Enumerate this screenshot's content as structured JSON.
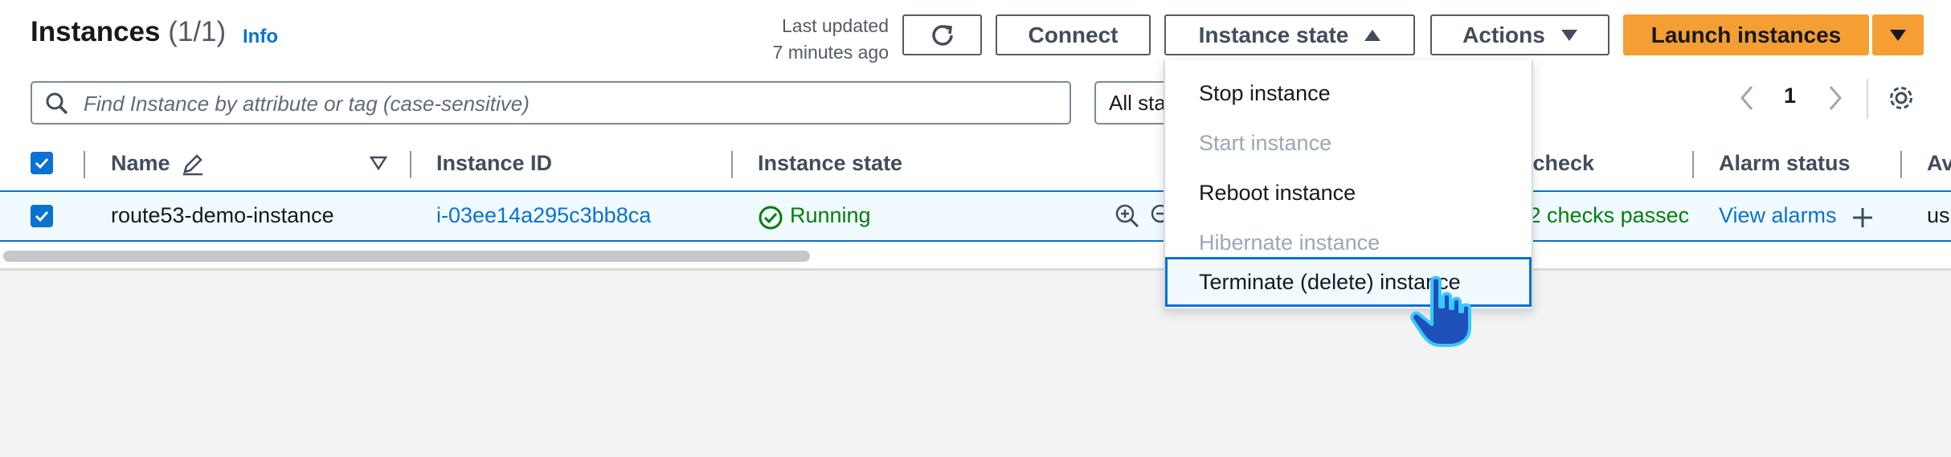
{
  "header": {
    "title": "Instances",
    "count": "(1/1)",
    "info": "Info",
    "last_updated_line1": "Last updated",
    "last_updated_line2": "7 minutes ago"
  },
  "toolbar": {
    "refresh_icon": "refresh-icon",
    "connect_label": "Connect",
    "instance_state_label": "Instance state",
    "actions_label": "Actions",
    "launch_label": "Launch instances"
  },
  "search": {
    "placeholder": "Find Instance by attribute or tag (case-sensitive)",
    "filter_value": "All sta"
  },
  "pagination": {
    "page": "1"
  },
  "table": {
    "columns": {
      "name": "Name",
      "instance_id": "Instance ID",
      "instance_state": "Instance state",
      "status_check": "s check",
      "alarm_status": "Alarm status",
      "availability_zone": "Av"
    },
    "row": {
      "name": "route53-demo-instance",
      "instance_id": "i-03ee14a295c3bb8ca",
      "state": "Running",
      "status_check": "2/2 checks passec",
      "alarm_link": "View alarms",
      "availability_zone": "us"
    }
  },
  "instance_state_menu": {
    "items": [
      {
        "label": "Stop instance",
        "enabled": true
      },
      {
        "label": "Start instance",
        "enabled": false
      },
      {
        "label": "Reboot instance",
        "enabled": true
      },
      {
        "label": "Hibernate instance",
        "enabled": false
      },
      {
        "label": "Terminate (delete) instance",
        "enabled": true
      }
    ]
  },
  "colors": {
    "accent": "#0972d3",
    "primary_button": "#f59e33",
    "running": "#037f0c",
    "disabled_text": "#9ba7b6"
  }
}
